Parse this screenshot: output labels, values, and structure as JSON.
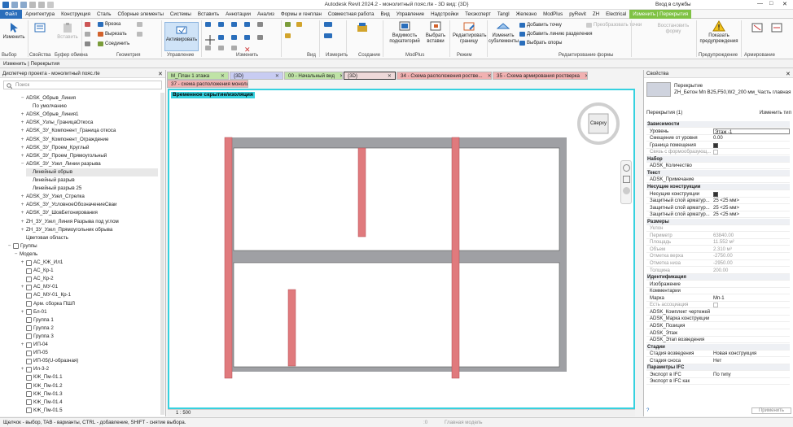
{
  "window": {
    "title": "Autodesk Revit 2024.2 - монолитный пояс.rte - 3D вид: {3D}",
    "signin": "Вход в службы",
    "colors": {
      "file_tab": "#2a6ebb",
      "context_tab": "#7fc244",
      "view_border": "#36d1df",
      "wall_fill": "#9fa0a4",
      "column_fill": "#e07a7d"
    }
  },
  "ribbon_tabs": [
    "Файл",
    "Архитектура",
    "Конструкция",
    "Сталь",
    "Сборные элементы",
    "Системы",
    "Вставить",
    "Аннотации",
    "Анализ",
    "Формы и генплан",
    "Совместная работа",
    "Вид",
    "Управление",
    "Надстройки",
    "Техэксперт",
    "Tangl",
    "Железно",
    "ModPlus",
    "pyRevit",
    "ZH",
    "Electrical",
    "Изменить | Перекрытия"
  ],
  "ribbon": {
    "modify": "Изменить",
    "paste": "Вставить",
    "properties_label": "Свойства",
    "cut": "Врезка",
    "cutout": "Вырезать",
    "join": "Соединить",
    "activate": "Активировать",
    "visibility": "Видимость подкатегорий",
    "choose_insert": "Выбрать вставки",
    "edit_boundary": "Редактировать границу",
    "modify_sub": "Изменить субэлементы",
    "add_point": "Добавить точку",
    "add_split_line": "Добавить линию разделения",
    "pick_supports": "Выбрать опоры",
    "convert_point": "Преобразовать точки",
    "restore_form": "Восстановить форму",
    "show_warnings": "Показать предупреждения",
    "groups": {
      "select": "Выбор",
      "props": "Свойства",
      "clipboard": "Буфер обмена",
      "geometry": "Геометрия",
      "control": "Управление",
      "modify": "Изменить",
      "view": "Вид",
      "measure": "Измерить",
      "create": "Создание",
      "modplus": "ModPlus",
      "mode": "Режим",
      "shape_edit": "Редактирование формы",
      "warnings": "Предупреждение",
      "rebar": "Армирование"
    }
  },
  "options_bar": "Изменить | Перекрытия",
  "project_browser": {
    "title": "Диспетчер проекта - монолитный пояс.rte",
    "search_placeholder": "Поиск",
    "items": [
      {
        "level": 2,
        "pm": "−",
        "label": "ADSK_Обрыв_Линия"
      },
      {
        "level": 3,
        "pm": "",
        "label": "По умолчанию"
      },
      {
        "level": 2,
        "pm": "+",
        "label": "ADSK_Обрыв_Линия1"
      },
      {
        "level": 2,
        "pm": "+",
        "label": "ADSK_Узлы_ГраницаОткоса"
      },
      {
        "level": 2,
        "pm": "+",
        "label": "ADSK_ЗУ_Компонент_Граница откоса"
      },
      {
        "level": 2,
        "pm": "+",
        "label": "ADSK_ЗУ_Компонент_Ограждение"
      },
      {
        "level": 2,
        "pm": "+",
        "label": "ADSK_ЗУ_Проем_Круглый"
      },
      {
        "level": 2,
        "pm": "+",
        "label": "ADSK_ЗУ_Проем_Прямоугольный"
      },
      {
        "level": 2,
        "pm": "−",
        "label": "ADSK_ЗУ_Узел_Линии разрыва"
      },
      {
        "level": 3,
        "pm": "",
        "label": "Линейный обрыв"
      },
      {
        "level": 3,
        "pm": "",
        "label": "Линейный разрыв"
      },
      {
        "level": 3,
        "pm": "",
        "label": "Линейный разрыв 25"
      },
      {
        "level": 2,
        "pm": "+",
        "label": "ADSK_ЗУ_Узел_Стрелка"
      },
      {
        "level": 2,
        "pm": "+",
        "label": "ADSK_ЗУ_УсловноеОбозначениеСваи"
      },
      {
        "level": 2,
        "pm": "+",
        "label": "ADSK_ЗУ_ШовБетонирования"
      },
      {
        "level": 2,
        "pm": "+",
        "label": "ZH_ЗУ_Узел_Линия Разрыва под углом"
      },
      {
        "level": 2,
        "pm": "+",
        "label": "ZH_ЗУ_Узел_Прямоугольник обрыва"
      },
      {
        "level": 2,
        "pm": "",
        "label": "Цветовая область"
      },
      {
        "level": 0,
        "pm": "−",
        "label": "Группы",
        "icon": true
      },
      {
        "level": 1,
        "pm": "−",
        "label": "Модель"
      },
      {
        "level": 2,
        "pm": "+",
        "label": "AC_КЖ_Ил1",
        "icon": true
      },
      {
        "level": 2,
        "pm": "",
        "label": "AC_Кр-1",
        "icon": true
      },
      {
        "level": 2,
        "pm": "",
        "label": "AC_Кр-2",
        "icon": true
      },
      {
        "level": 2,
        "pm": "+",
        "label": "AC_МУ-01",
        "icon": true
      },
      {
        "level": 2,
        "pm": "",
        "label": "AC_МУ-01_Кр-1",
        "icon": true
      },
      {
        "level": 2,
        "pm": "",
        "label": "Арм. сборка ПШЛ",
        "icon": true
      },
      {
        "level": 2,
        "pm": "+",
        "label": "Бл-01",
        "icon": true
      },
      {
        "level": 2,
        "pm": "",
        "label": "Группа 1",
        "icon": true
      },
      {
        "level": 2,
        "pm": "",
        "label": "Группа 2",
        "icon": true
      },
      {
        "level": 2,
        "pm": "",
        "label": "Группа 3",
        "icon": true
      },
      {
        "level": 2,
        "pm": "+",
        "label": "ИП-04",
        "icon": true
      },
      {
        "level": 2,
        "pm": "",
        "label": "ИП-05",
        "icon": true
      },
      {
        "level": 2,
        "pm": "",
        "label": "ИП-05(U-образная)",
        "icon": true
      },
      {
        "level": 2,
        "pm": "+",
        "label": "Ил-3-2",
        "icon": true
      },
      {
        "level": 2,
        "pm": "",
        "label": "КЖ_Пм-01.1",
        "icon": true
      },
      {
        "level": 2,
        "pm": "",
        "label": "КЖ_Пм-01.2",
        "icon": true
      },
      {
        "level": 2,
        "pm": "",
        "label": "КЖ_Пм-01.3",
        "icon": true
      },
      {
        "level": 2,
        "pm": "",
        "label": "КЖ_Пм-01.4",
        "icon": true
      },
      {
        "level": 2,
        "pm": "",
        "label": "КЖ_Пм-01.5",
        "icon": true
      }
    ]
  },
  "view_tabs_row1": [
    {
      "label": "М_План 1 этажа",
      "color": "#bfe3a6"
    },
    {
      "label": "{3D}",
      "color": "#c8ccf2"
    },
    {
      "label": "00 - Начальный вид",
      "color": "#bfe3a6"
    },
    {
      "label": "{3D}",
      "color": "#eed9d9",
      "active": true
    },
    {
      "label": "34 - Схема расположения ростве...",
      "color": "#f1b1b1"
    },
    {
      "label": "35 - Схема армирования ростверка",
      "color": "#f1b1b1"
    }
  ],
  "view_tabs_row2": [
    {
      "label": "37 - схема расположения моноли...",
      "color": "#f1b1b1"
    }
  ],
  "view": {
    "mode_label": "Временное скрытие/изоляция",
    "cube_label": "Сверху",
    "scale": "1 : 500"
  },
  "properties": {
    "title": "Свойства",
    "type_name": "Перекрытие",
    "type_sub": "ZH_Бетон Мп В25,F50,W2_200 мм_Часть главная",
    "selection": "Перекрытия (1)",
    "edit_type": "Изменить тип",
    "apply": "Применить",
    "rows": [
      {
        "cat": true,
        "k": "Зависимости"
      },
      {
        "k": "Уровень",
        "v": "Этаж -1",
        "boxed": true
      },
      {
        "k": "Смещение от уровня",
        "v": "0.00"
      },
      {
        "k": "Граница помещения",
        "cb": "on"
      },
      {
        "k": "Связь с формообразующ...",
        "cb": "off",
        "dim": true
      },
      {
        "cat": true,
        "k": "Набор"
      },
      {
        "k": "ADSK_Количество",
        "v": ""
      },
      {
        "cat": true,
        "k": "Текст"
      },
      {
        "k": "ADSK_Примечание",
        "v": ""
      },
      {
        "cat": true,
        "k": "Несущие конструкции"
      },
      {
        "k": "Несущие конструкции",
        "cb": "on"
      },
      {
        "k": "Защитный слой арматур...",
        "v": "25 <25 мм>"
      },
      {
        "k": "Защитный слой арматур...",
        "v": "25 <25 мм>"
      },
      {
        "k": "Защитный слой арматур...",
        "v": "25 <25 мм>"
      },
      {
        "cat": true,
        "k": "Размеры"
      },
      {
        "k": "Уклон",
        "v": "",
        "dim": true
      },
      {
        "k": "Периметр",
        "v": "63840.00",
        "dim": true
      },
      {
        "k": "Площадь",
        "v": "11.552 м²",
        "dim": true
      },
      {
        "k": "Объем",
        "v": "2.310 м³",
        "dim": true
      },
      {
        "k": "Отметка верха",
        "v": "-2750.00",
        "dim": true
      },
      {
        "k": "Отметка низа",
        "v": "-2950.00",
        "dim": true
      },
      {
        "k": "Толщина",
        "v": "200.00",
        "dim": true
      },
      {
        "cat": true,
        "k": "Идентификация"
      },
      {
        "k": "Изображение",
        "v": ""
      },
      {
        "k": "Комментарии",
        "v": ""
      },
      {
        "k": "Марка",
        "v": "Мп-1"
      },
      {
        "k": "Есть ассоциация",
        "cb": "off",
        "dim": true
      },
      {
        "k": "ADSK_Комплект чертежей",
        "v": ""
      },
      {
        "k": "ADSK_Марка конструкции",
        "v": ""
      },
      {
        "k": "ADSK_Позиция",
        "v": ""
      },
      {
        "k": "ADSK_Этаж",
        "v": ""
      },
      {
        "k": "ADSK_Этап возведения",
        "v": ""
      },
      {
        "cat": true,
        "k": "Стадии"
      },
      {
        "k": "Стадия возведения",
        "v": "Новая конструкция"
      },
      {
        "k": "Стадия сноса",
        "v": "Нет"
      },
      {
        "cat": true,
        "k": "Параметры IFC"
      },
      {
        "k": "Экспорт в IFC",
        "v": "По типу"
      },
      {
        "k": "Экспорт в IFC как",
        "v": ""
      }
    ]
  },
  "status": {
    "hint": "Щелчок - выбор, TAB - варианты, CTRL - добавление, SHIFT - снятие выбора.",
    "model": "Главная модель",
    "zero": ":0"
  }
}
